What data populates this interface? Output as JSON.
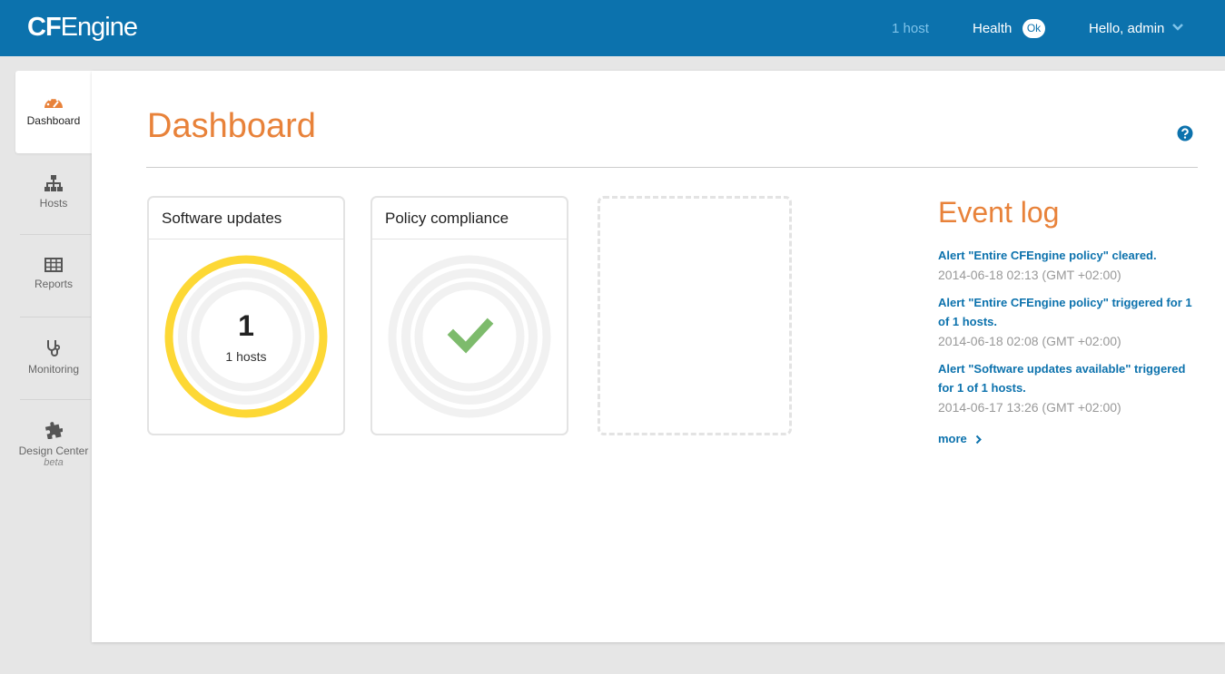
{
  "header": {
    "logo_cf": "CF",
    "logo_engine": "Engine",
    "hosts_count": "1 host",
    "health_label": "Health",
    "health_status": "Ok",
    "user_greeting": "Hello, admin"
  },
  "sidebar": {
    "items": [
      {
        "label": "Dashboard",
        "icon": "speedometer-icon"
      },
      {
        "label": "Hosts",
        "icon": "hierarchy-icon"
      },
      {
        "label": "Reports",
        "icon": "table-icon"
      },
      {
        "label": "Monitoring",
        "icon": "stethoscope-icon"
      },
      {
        "label": "Design Center",
        "sublabel": "beta",
        "icon": "puzzle-icon"
      }
    ]
  },
  "main": {
    "title": "Dashboard",
    "cards": [
      {
        "title": "Software updates",
        "value": "1",
        "value_label": "1 hosts",
        "ring_color": "#fdd835"
      },
      {
        "title": "Policy compliance",
        "status": "check",
        "check_color": "#7dbb6c"
      }
    ]
  },
  "event_log": {
    "title": "Event log",
    "events": [
      {
        "text": "Alert \"Entire CFEngine policy\" cleared.",
        "time": "2014-06-18 02:13 (GMT +02:00)"
      },
      {
        "text": "Alert \"Entire CFEngine policy\" triggered for 1 of 1 hosts.",
        "time": "2014-06-18 02:08 (GMT +02:00)"
      },
      {
        "text": "Alert \"Software updates available\" triggered for 1 of 1 hosts.",
        "time": "2014-06-17 13:26 (GMT +02:00)"
      }
    ],
    "more_label": "more"
  },
  "colors": {
    "header_bg": "#0c72ad",
    "accent_orange": "#e8823a",
    "link_blue": "#0c72ad"
  }
}
